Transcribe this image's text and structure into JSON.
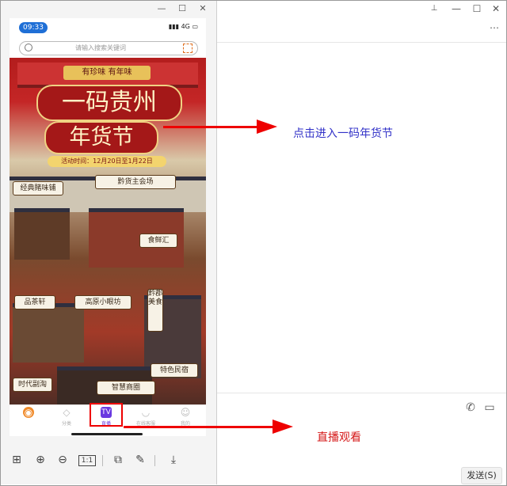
{
  "phone": {
    "status_time": "09:33",
    "status_network": "4G",
    "search_placeholder": "请输入搜索关键词",
    "banner": {
      "tagline": "有珍味 有年味",
      "title_line1": "一码贵州",
      "title_line2": "年货节",
      "activity_time": "活动时间：12月20日至1月22日",
      "signs": [
        "经典賭味铺",
        "黔货主会场",
        "食鲜汇",
        "品茶轩",
        "高原小眼坊",
        "黔郡美食",
        "时代副淘",
        "智慧商圈",
        "特色民宿"
      ]
    },
    "tabs": [
      {
        "label": "",
        "icon": "home-logo-icon"
      },
      {
        "label": "分类",
        "icon": "category-icon"
      },
      {
        "label": "直播",
        "icon": "live-icon"
      },
      {
        "label": "在线客服",
        "icon": "service-icon"
      },
      {
        "label": "我的",
        "icon": "profile-icon"
      }
    ]
  },
  "viewer_tools": [
    "grid-icon",
    "zoom-in-icon",
    "zoom-out-icon",
    "actual-size-icon",
    "rotate-icon",
    "edit-icon",
    "download-icon"
  ],
  "viewer_tool_actual_size": "1:1",
  "annotations": {
    "enter": "点击进入一码年货节",
    "live": "直播观看"
  },
  "chat": {
    "send_button": "发送(S)"
  },
  "colors": {
    "annotation_blue": "#3232c8",
    "annotation_red": "#d51818",
    "arrow_red": "#ee0000",
    "live_tab_purple": "#6a3ae0"
  }
}
